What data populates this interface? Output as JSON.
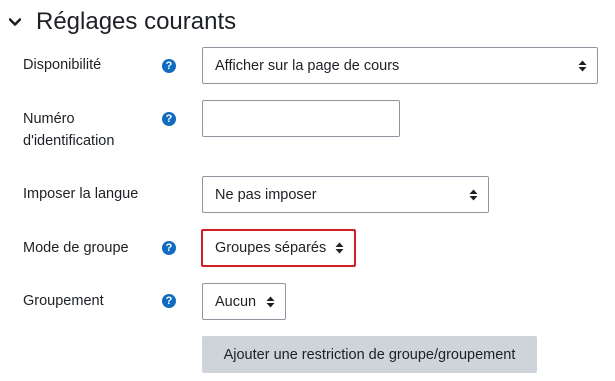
{
  "section": {
    "title": "Réglages courants",
    "icon": "chevron-down-icon"
  },
  "fields": {
    "disponibilite": {
      "label": "Disponibilité",
      "value": "Afficher sur la page de cours"
    },
    "idnumber": {
      "label_line1": "Numéro",
      "label_line2": "d'identification",
      "value": ""
    },
    "langue": {
      "label": "Imposer la langue",
      "value": "Ne pas imposer"
    },
    "groupmode": {
      "label": "Mode de groupe",
      "value": "Groupes séparés"
    },
    "groupement": {
      "label": "Groupement",
      "value": "Aucun"
    }
  },
  "help_icon_glyph": "?",
  "button": {
    "label": "Ajouter une restriction de groupe/groupement"
  },
  "colors": {
    "help_icon": "#0f6cbf",
    "highlight_border": "#d21e24",
    "button_bg": "#ced4da"
  }
}
